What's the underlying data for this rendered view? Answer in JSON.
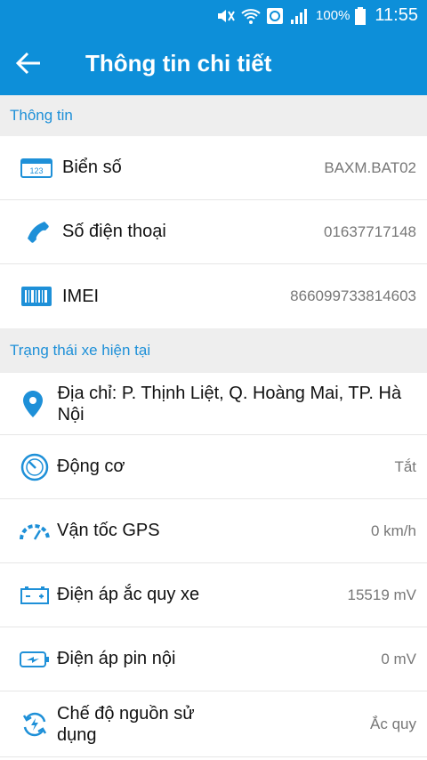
{
  "status": {
    "battery": "100%",
    "time": "11:55"
  },
  "header": {
    "title": "Thông tin chi tiết"
  },
  "info_section": {
    "title": "Thông tin"
  },
  "info_rows": [
    {
      "label": "Biển số",
      "value": "BAXM.BAT02"
    },
    {
      "label": "Số điện thoại",
      "value": "01637717148"
    },
    {
      "label": "IMEI",
      "value": "866099733814603"
    }
  ],
  "state_section": {
    "title": "Trạng thái xe hiện tại"
  },
  "address": {
    "text": "Địa chỉ: P. Thịnh Liệt, Q. Hoàng Mai, TP. Hà Nội"
  },
  "state_rows": [
    {
      "label": "Động cơ",
      "value": "Tắt"
    },
    {
      "label": "Vận tốc GPS",
      "value": "0 km/h"
    },
    {
      "label": "Điện áp ắc quy xe",
      "value": "15519 mV"
    },
    {
      "label": "Điện áp pin nội",
      "value": "0 mV"
    },
    {
      "label": "Chế độ nguồn sử dụng",
      "value": "Ắc quy"
    }
  ],
  "colors": {
    "primary": "#0d8fd9",
    "section_bg": "#eeeeee",
    "section_text": "#1e90d8"
  }
}
